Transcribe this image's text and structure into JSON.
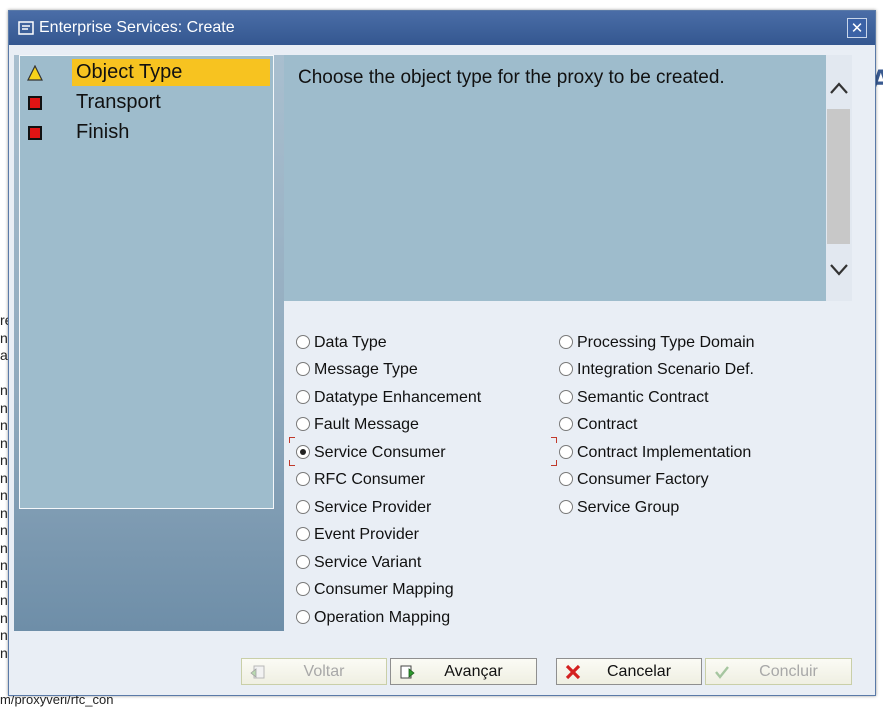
{
  "background": {
    "side_letters": [
      "re",
      "n",
      "a",
      "",
      "n",
      "n",
      "n",
      "n",
      "n",
      "n",
      "n",
      "n",
      "n",
      "n",
      "n",
      "n",
      "n",
      "n",
      "n",
      "n"
    ],
    "path_text": "m/proxyveri/rfc_con",
    "right_letter": "A"
  },
  "dialog": {
    "title": "Enterprise Services: Create",
    "close_label": "✕"
  },
  "nav": {
    "items": [
      {
        "label": "Object Type",
        "icon": "warning-triangle-icon",
        "active": true
      },
      {
        "label": "Transport",
        "icon": "red-square-icon",
        "active": false
      },
      {
        "label": "Finish",
        "icon": "red-square-icon",
        "active": false
      }
    ]
  },
  "info": {
    "text": "Choose the object type for the proxy to be created."
  },
  "options": {
    "left": [
      {
        "label": "Data Type",
        "checked": false
      },
      {
        "label": "Message Type",
        "checked": false
      },
      {
        "label": "Datatype Enhancement",
        "checked": false
      },
      {
        "label": "Fault Message",
        "checked": false
      },
      {
        "label": "Service Consumer",
        "checked": true
      },
      {
        "label": "RFC Consumer",
        "checked": false
      },
      {
        "label": "Service Provider",
        "checked": false
      },
      {
        "label": "Event Provider",
        "checked": false
      },
      {
        "label": "Service Variant",
        "checked": false
      },
      {
        "label": "Consumer Mapping",
        "checked": false
      },
      {
        "label": "Operation Mapping",
        "checked": false
      }
    ],
    "right": [
      {
        "label": "Processing Type Domain",
        "checked": false
      },
      {
        "label": "Integration Scenario Def.",
        "checked": false
      },
      {
        "label": "Semantic Contract",
        "checked": false
      },
      {
        "label": "Contract",
        "checked": false
      },
      {
        "label": "Contract Implementation",
        "checked": false
      },
      {
        "label": "Consumer Factory",
        "checked": false
      },
      {
        "label": "Service Group",
        "checked": false
      }
    ]
  },
  "buttons": {
    "back": "Voltar",
    "next": "Avançar",
    "cancel": "Cancelar",
    "finish": "Concluir"
  },
  "colors": {
    "title_bar": "#345790",
    "active_step": "#f7c320",
    "panel": "#9ebccc"
  }
}
